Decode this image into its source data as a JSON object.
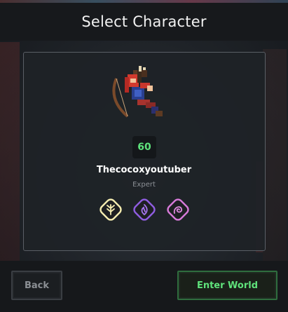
{
  "header": {
    "title": "Select Character"
  },
  "character": {
    "level": "60",
    "name": "Thecocoxyoutuber",
    "class_label": "Expert",
    "badges": [
      {
        "icon": "tree-crest-icon",
        "color": "#f4ecb0"
      },
      {
        "icon": "flame-crest-icon",
        "color": "#8f5de0"
      },
      {
        "icon": "swirl-crest-icon",
        "color": "#d77ad9"
      }
    ]
  },
  "footer": {
    "back_label": "Back",
    "enter_label": "Enter World"
  },
  "colors": {
    "level_green": "#5ee37c",
    "enter_green": "#5fe27b",
    "panel_border": "#5a5f66"
  }
}
